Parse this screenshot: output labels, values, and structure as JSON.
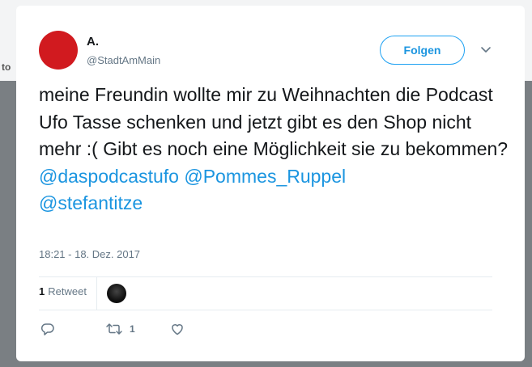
{
  "backdrop": {
    "edge_text": "to",
    "bottom_text": "··· ···"
  },
  "user": {
    "name": "A.",
    "handle": "@StadtAmMain",
    "avatar_color": "#d11a1f"
  },
  "follow_button": {
    "label": "Folgen"
  },
  "tweet": {
    "text": "meine Freundin wollte mir zu Weihnachten die Podcast Ufo Tasse schenken und jetzt gibt es den Shop nicht mehr :( Gibt es noch eine Möglichkeit sie zu bekommen?",
    "mentions": [
      "@daspodcastufo",
      "@Pommes_Ruppel",
      "@stefantitze"
    ],
    "timestamp": "18:21 - 18. Dez. 2017"
  },
  "stats": {
    "retweet_count": "1",
    "retweet_label": "Retweet"
  },
  "actions": {
    "reply_icon": "reply-icon",
    "retweet_icon": "retweet-icon",
    "retweet_count": "1",
    "like_icon": "heart-icon"
  },
  "colors": {
    "accent": "#1da1f2",
    "mention": "#1b95e0",
    "muted": "#657786"
  }
}
